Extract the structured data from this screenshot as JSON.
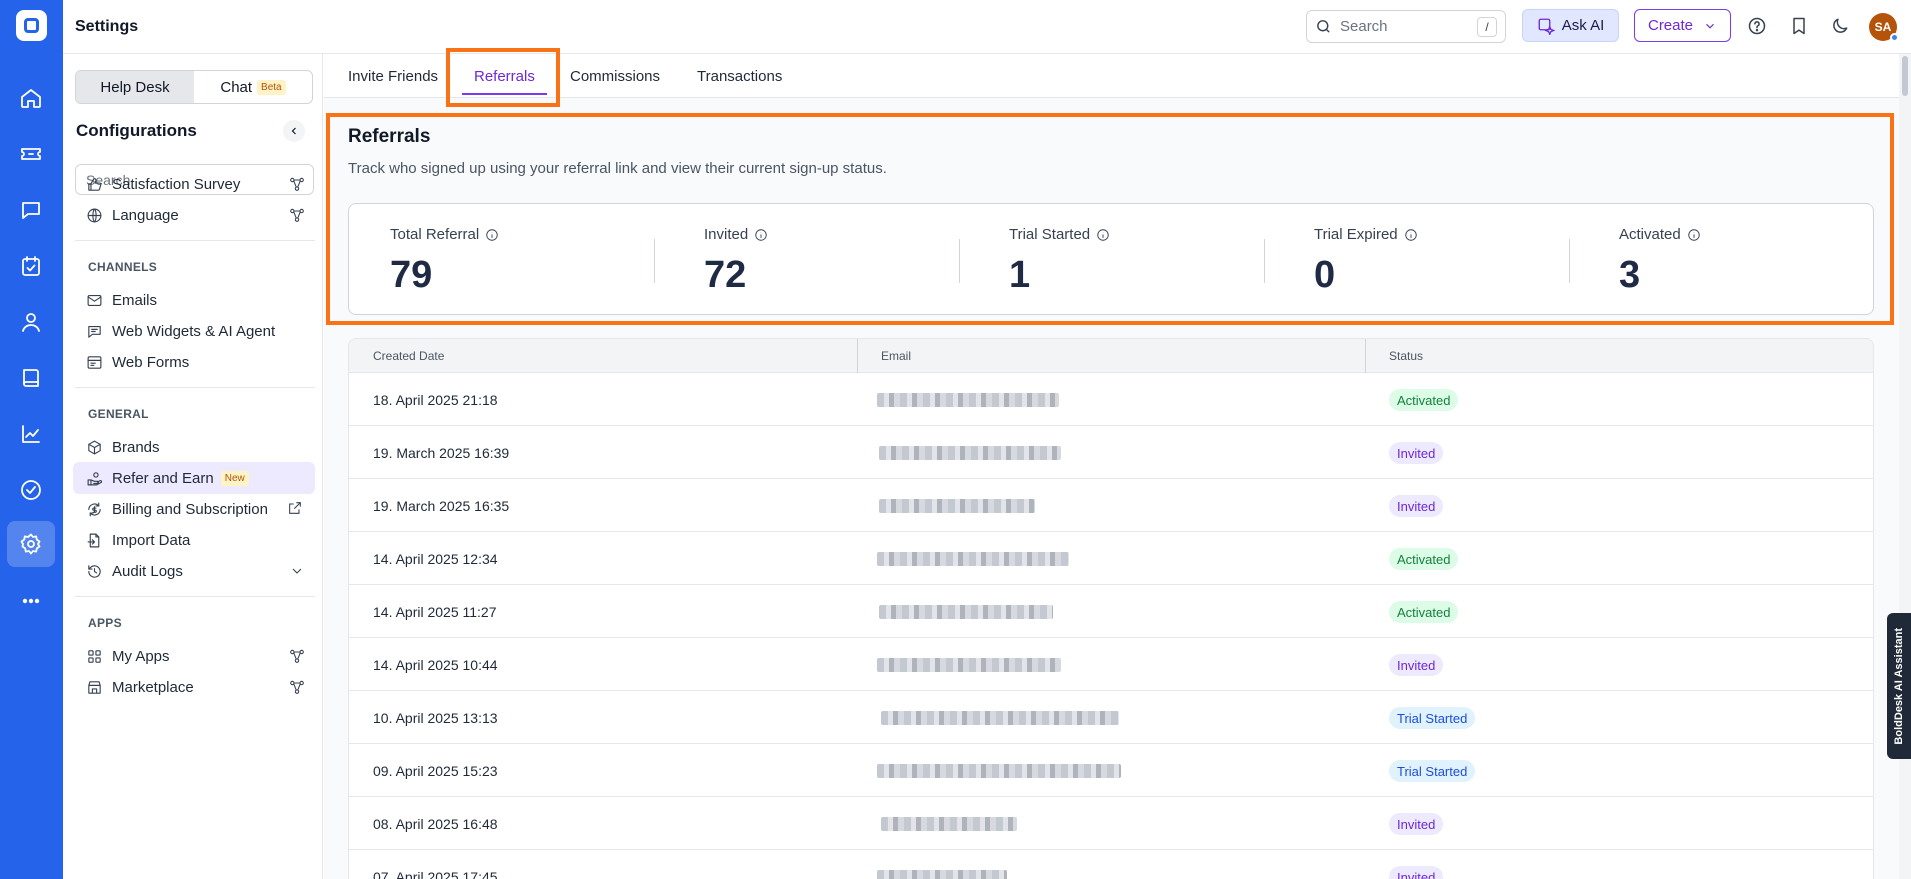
{
  "header": {
    "title": "Settings",
    "search_placeholder": "Search",
    "search_shortcut": "/",
    "ask_ai_label": "Ask AI",
    "create_label": "Create",
    "avatar_initials": "SA"
  },
  "rail": {
    "items": [
      "home-icon",
      "ticket-icon",
      "chat-icon",
      "calendar-check-icon",
      "contact-icon",
      "knowledge-book-icon",
      "analytics-icon",
      "task-icon",
      "settings-icon",
      "more-icon"
    ],
    "active": "settings-icon"
  },
  "sidebar": {
    "segment": {
      "helpdesk": "Help Desk",
      "chat": "Chat",
      "beta": "Beta"
    },
    "title": "Configurations",
    "search_placeholder": "Search",
    "top_items": [
      {
        "label": "Satisfaction Survey"
      },
      {
        "label": "Language"
      }
    ],
    "channels_label": "CHANNELS",
    "channels": [
      {
        "label": "Emails"
      },
      {
        "label": "Web Widgets & AI Agent"
      },
      {
        "label": "Web Forms"
      }
    ],
    "general_label": "GENERAL",
    "general": [
      {
        "label": "Brands"
      },
      {
        "label": "Refer and Earn",
        "badge": "New"
      },
      {
        "label": "Billing and Subscription"
      },
      {
        "label": "Import Data"
      },
      {
        "label": "Audit Logs"
      }
    ],
    "apps_label": "APPS",
    "apps": [
      {
        "label": "My Apps"
      },
      {
        "label": "Marketplace"
      }
    ]
  },
  "tabs": [
    {
      "label": "Invite Friends"
    },
    {
      "label": "Referrals"
    },
    {
      "label": "Commissions"
    },
    {
      "label": "Transactions"
    }
  ],
  "active_tab": "Referrals",
  "referrals": {
    "title": "Referrals",
    "description": "Track who signed up using your referral link and view their current sign-up status.",
    "stats": [
      {
        "label": "Total Referral",
        "value": "79"
      },
      {
        "label": "Invited",
        "value": "72"
      },
      {
        "label": "Trial Started",
        "value": "1"
      },
      {
        "label": "Trial Expired",
        "value": "0"
      },
      {
        "label": "Activated",
        "value": "3"
      }
    ]
  },
  "table": {
    "columns": [
      "Created Date",
      "Email",
      "Status"
    ],
    "rows": [
      {
        "date": "18. April 2025 21:18",
        "status": "Activated"
      },
      {
        "date": "19. March 2025 16:39",
        "status": "Invited"
      },
      {
        "date": "19. March 2025 16:35",
        "status": "Invited"
      },
      {
        "date": "14. April 2025 12:34",
        "status": "Activated"
      },
      {
        "date": "14. April 2025 11:27",
        "status": "Activated"
      },
      {
        "date": "14. April 2025 10:44",
        "status": "Invited"
      },
      {
        "date": "10. April 2025 13:13",
        "status": "Trial Started"
      },
      {
        "date": "09. April 2025 15:23",
        "status": "Trial Started"
      },
      {
        "date": "08. April 2025 16:48",
        "status": "Invited"
      },
      {
        "date": "07. April 2025 17:45",
        "status": "Invited"
      }
    ]
  },
  "assistant_tab": "BoldDesk AI Assistant",
  "colors": {
    "brand": "#2563eb",
    "accent": "#7c3aed",
    "highlight": "#f97316"
  }
}
